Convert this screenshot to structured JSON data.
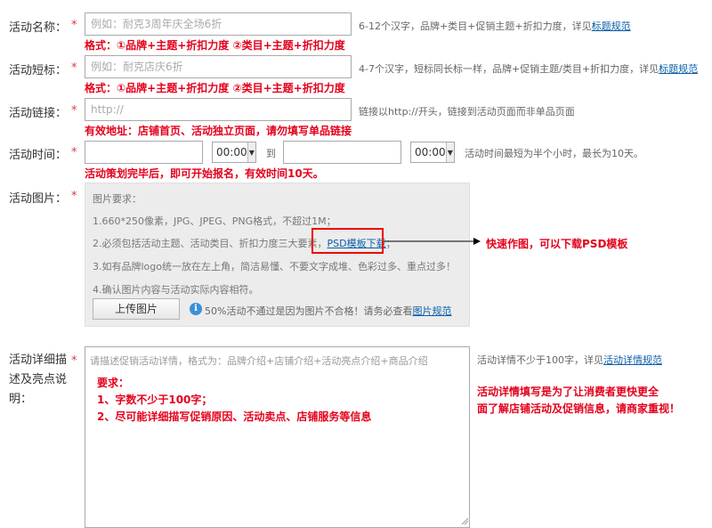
{
  "row_name": {
    "label": "活动名称：",
    "required": "*",
    "placeholder": "例如：耐克3周年庆全场6折",
    "hint_text": "6-12个汉字，品牌+类目+促销主题+折扣力度，详见",
    "hint_link": "标题规范",
    "format_note": "格式：①品牌+主题+折扣力度 ②类目+主题+折扣力度"
  },
  "row_short": {
    "label": "活动短标：",
    "required": "*",
    "placeholder": "例如：耐克店庆6折",
    "hint_text": "4-7个汉字，短标同长标一样，品牌+促销主题/类目+折扣力度，详见",
    "hint_link": "标题规范",
    "format_note": "格式：①品牌+主题+折扣力度 ②类目+主题+折扣力度"
  },
  "row_link": {
    "label": "活动链接：",
    "required": "*",
    "placeholder": "http://",
    "hint_text": "链接以http://开头，链接到活动页面而非单品页面",
    "note": "有效地址：店铺首页、活动独立页面，请勿填写单品链接"
  },
  "row_time": {
    "label": "活动时间：",
    "required": "*",
    "start_time": "00:00",
    "to_label": "到",
    "end_time": "00:00",
    "hint_text": "活动时间最短为半个小时，最长为10天。",
    "note": "活动策划完毕后，即可开始报名，有效时间10天。"
  },
  "row_image": {
    "label": "活动图片：",
    "required": "*",
    "req_title": "图片要求：",
    "req1": "1.660*250像素，JPG、JPEG、PNG格式，不超过1M；",
    "req2_text": "2.必须包括活动主题、活动类目、折扣力度三大要素，",
    "req2_link": "PSD模板下载",
    "req2_tail": "；",
    "req3": "3.如有品牌logo统一放在左上角，简洁易懂、不要文字成堆、色彩过多、重点过多！",
    "req4": "4.确认图片内容与活动实际内容相符。",
    "upload_label": "上传图片",
    "info_icon_glyph": "i",
    "fail_text": "50%活动不通过是因为图片不合格！请务必查看",
    "fail_link": "图片规范",
    "callout": "快速作图，可以下载PSD模板"
  },
  "row_detail": {
    "label_line1": "活动详细描",
    "label_line2": "述及亮点说",
    "label_line3": "明：",
    "required": "*",
    "placeholder": "请描述促销活动详情，格式为：品牌介绍+店铺介绍+活动亮点介绍+商品介绍",
    "req_title": "要求：",
    "req1": "1、字数不少于100字；",
    "req2": "2、尽可能详细描写促销原因、活动卖点、店铺服务等信息",
    "hint_text": "活动详情不少于100字，详见",
    "hint_link": "活动详情规范",
    "note_line1": "活动详情填写是为了让消费者更快更全",
    "note_line2": "面了解店铺活动及促销信息，请商家重视！"
  }
}
